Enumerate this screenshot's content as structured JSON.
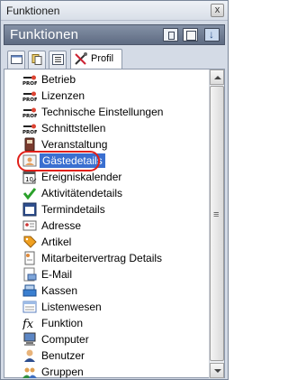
{
  "window": {
    "title": "Funktionen",
    "close": "x"
  },
  "panel": {
    "title": "Funktionen"
  },
  "tabs": {
    "active_label": "Profil"
  },
  "items": [
    {
      "label": "Betrieb",
      "icon": "profil-icon"
    },
    {
      "label": "Lizenzen",
      "icon": "profil-icon"
    },
    {
      "label": "Technische Einstellungen",
      "icon": "profil-icon"
    },
    {
      "label": "Schnittstellen",
      "icon": "profil-icon"
    },
    {
      "label": "Veranstaltung",
      "icon": "event-icon"
    },
    {
      "label": "Gästedetails",
      "icon": "guest-icon",
      "selected": true
    },
    {
      "label": "Ereigniskalender",
      "icon": "calendar-icon"
    },
    {
      "label": "Aktivitätendetails",
      "icon": "checkmark-icon"
    },
    {
      "label": "Termindetails",
      "icon": "appointment-icon"
    },
    {
      "label": "Adresse",
      "icon": "address-card-icon"
    },
    {
      "label": "Artikel",
      "icon": "tag-icon"
    },
    {
      "label": "Mitarbeitervertrag Details",
      "icon": "contract-icon"
    },
    {
      "label": "E-Mail",
      "icon": "email-icon"
    },
    {
      "label": "Kassen",
      "icon": "cash-register-icon"
    },
    {
      "label": "Listenwesen",
      "icon": "list-icon"
    },
    {
      "label": "Funktion",
      "icon": "function-fx-icon"
    },
    {
      "label": "Computer",
      "icon": "computer-icon"
    },
    {
      "label": "Benutzer",
      "icon": "user-icon"
    },
    {
      "label": "Gruppen",
      "icon": "group-icon"
    }
  ],
  "colors": {
    "selection": "#3a6fd0",
    "highlight_ring": "#e0201a",
    "header": "#6b788e"
  }
}
